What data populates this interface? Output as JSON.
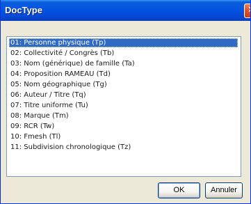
{
  "window": {
    "title": "DocType",
    "close_glyph": "✕"
  },
  "doctype_list": {
    "selected_index": 0,
    "items": [
      "01: Personne physique (Tp)",
      "02: Collectivité / Congrès (Tb)",
      "03: Nom (générique) de famille (Ta)",
      "04: Proposition RAMEAU (Td)",
      "05: Nom géographique (Tg)",
      "06: Auteur / Titre (Tq)",
      "07: Titre uniforme (Tu)",
      "08: Marque (Tm)",
      "09: RCR (Tw)",
      "10: Fmesh (Tl)",
      "11: Subdivision chronologique (Tz)"
    ]
  },
  "buttons": {
    "ok_label": "OK",
    "cancel_label": "Annuler"
  },
  "colors": {
    "title_bar": "#0554e3",
    "selection": "#316ac5",
    "dialog_bg": "#ece9d8"
  }
}
